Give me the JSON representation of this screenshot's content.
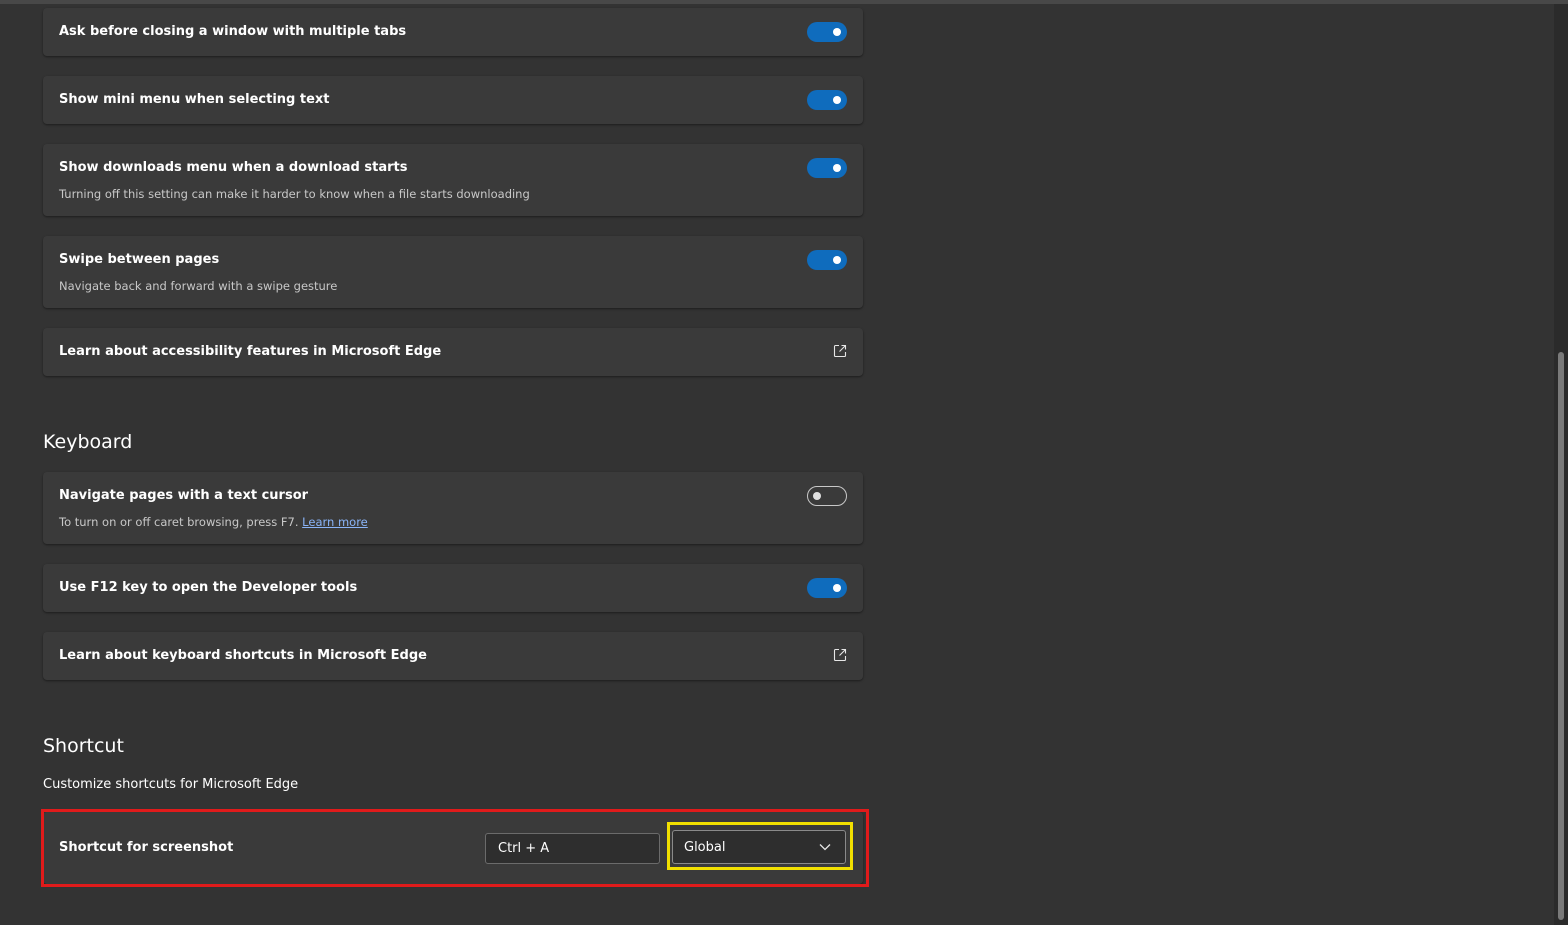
{
  "general": {
    "items": [
      {
        "title": "Ask before closing a window with multiple tabs",
        "toggle": "on"
      },
      {
        "title": "Show mini menu when selecting text",
        "toggle": "on"
      },
      {
        "title": "Show downloads menu when a download starts",
        "desc": "Turning off this setting can make it harder to know when a file starts downloading",
        "toggle": "on"
      },
      {
        "title": "Swipe between pages",
        "desc": "Navigate back and forward with a swipe gesture",
        "toggle": "on"
      },
      {
        "title": "Learn about accessibility features in Microsoft Edge",
        "icon": "external-link-icon"
      }
    ]
  },
  "keyboard": {
    "heading": "Keyboard",
    "items": [
      {
        "title": "Navigate pages with a text cursor",
        "desc": "To turn on or off caret browsing, press F7. ",
        "link": "Learn more",
        "toggle": "off"
      },
      {
        "title": "Use F12 key to open the Developer tools",
        "toggle": "on"
      },
      {
        "title": "Learn about keyboard shortcuts in Microsoft Edge",
        "icon": "external-link-icon"
      }
    ]
  },
  "shortcut": {
    "heading": "Shortcut",
    "subtitle": "Customize shortcuts for Microsoft Edge",
    "row_title": "Shortcut for screenshot",
    "keys_value": "Ctrl + A",
    "scope_selected": "Global"
  },
  "colors": {
    "background": "#333333",
    "card": "#3a3a3a",
    "toggle_on": "#0f6cbd",
    "highlight_red": "#e01b1b",
    "highlight_yellow": "#f2e000",
    "link": "#8ab4f8"
  }
}
